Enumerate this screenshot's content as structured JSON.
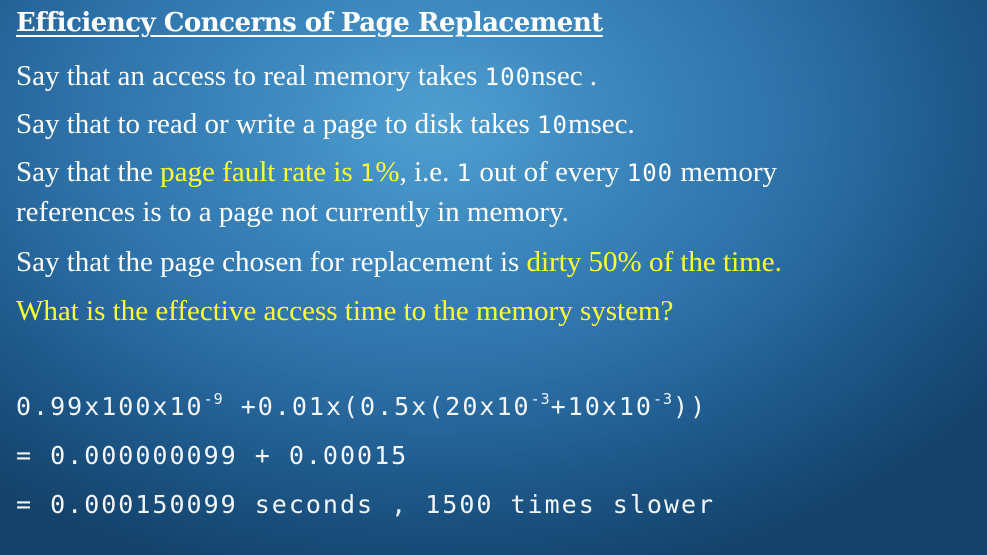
{
  "slide": {
    "title": "Efficiency Concerns of Page Replacement",
    "line1": {
      "a": "Say that an access to real memory takes ",
      "b": "100",
      "c": "nsec ."
    },
    "line2": {
      "a": "Say that to read or write a page to disk takes ",
      "b": "10",
      "c": "msec."
    },
    "line3": {
      "a": "Say that the ",
      "b": "page fault rate is ",
      "c": "1",
      "d": "%",
      "e": ", i.e. ",
      "f": "1",
      "g": " out of every ",
      "h": "100",
      "i": " memory"
    },
    "line4": "references is to a page not currently in memory.",
    "line5": {
      "a": "Say that the page chosen for replacement is ",
      "b": "dirty 50% of the time."
    },
    "line6": "What is the effective access time to the memory system?",
    "calc1": {
      "a": "0.99x100x10",
      "b": "-9",
      "c": " +0.01x(0.5x(20x10",
      "d": "-3",
      "e": "+10x10",
      "f": "-3",
      "g": "))"
    },
    "calc2": "= 0.000000099 + 0.00015",
    "calc3": "= 0.000150099 seconds , 1500 times slower"
  },
  "colors": {
    "highlight": "#ffff33",
    "text": "#ffffff"
  }
}
